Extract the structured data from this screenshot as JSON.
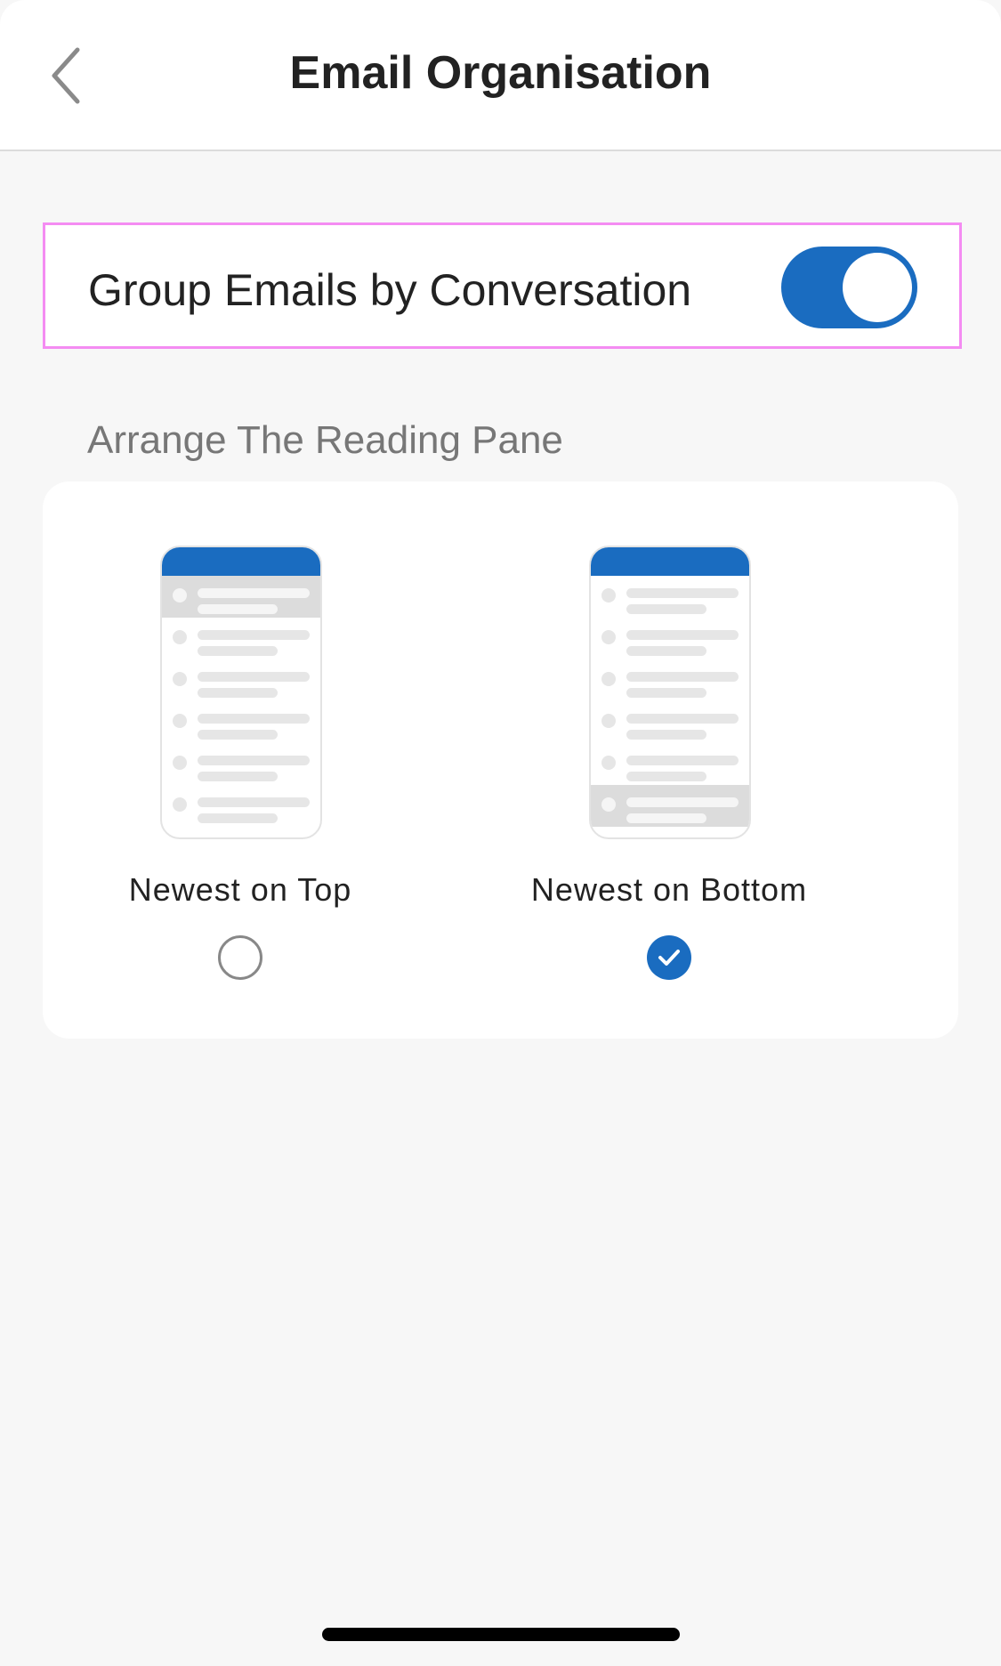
{
  "header": {
    "title": "Email Organisation",
    "back_icon": "chevron-left-icon"
  },
  "group_emails": {
    "label": "Group Emails by Conversation",
    "enabled": true,
    "accent_color": "#1a6cc0"
  },
  "reading_pane": {
    "section_label": "Arrange The Reading Pane",
    "options": [
      {
        "label": "Newest on Top",
        "selected": false
      },
      {
        "label": "Newest on Bottom",
        "selected": true
      }
    ]
  }
}
